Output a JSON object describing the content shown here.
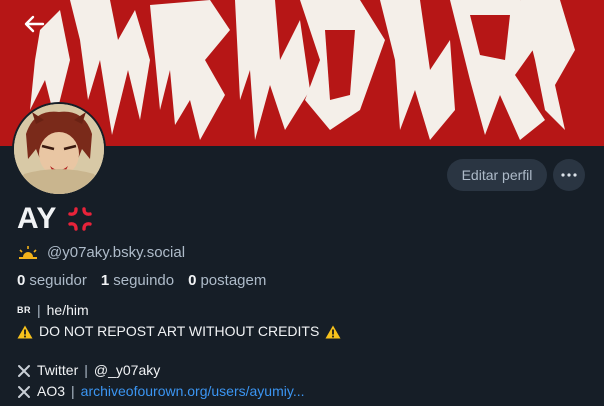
{
  "profile": {
    "display_name": "AY",
    "handle": "@y07aky.bsky.social",
    "stats": {
      "followers_count": "0",
      "followers_label": "seguidor",
      "following_count": "1",
      "following_label": "seguindo",
      "posts_count": "0",
      "posts_label": "postagem"
    },
    "edit_label": "Editar perfil",
    "bio": {
      "flag": "BR",
      "pronouns": "he/him",
      "warning": "DO NOT REPOST ART WITHOUT CREDITS",
      "twitter_label": "Twitter",
      "twitter_handle": "@_y07aky",
      "ao3_label": "AO3",
      "ao3_link": "archiveofourown.org/users/ayumiy..."
    }
  },
  "banner": {
    "logo_text": "PSIKOLLERA"
  },
  "colors": {
    "background": "#161e27",
    "banner": "#b61616",
    "button": "#2a3542",
    "link": "#3b95f2"
  },
  "icons": [
    "back-arrow-icon",
    "more-icon",
    "anger-symbol-icon",
    "sun-icon",
    "warning-icon",
    "cross-mark-icon"
  ]
}
